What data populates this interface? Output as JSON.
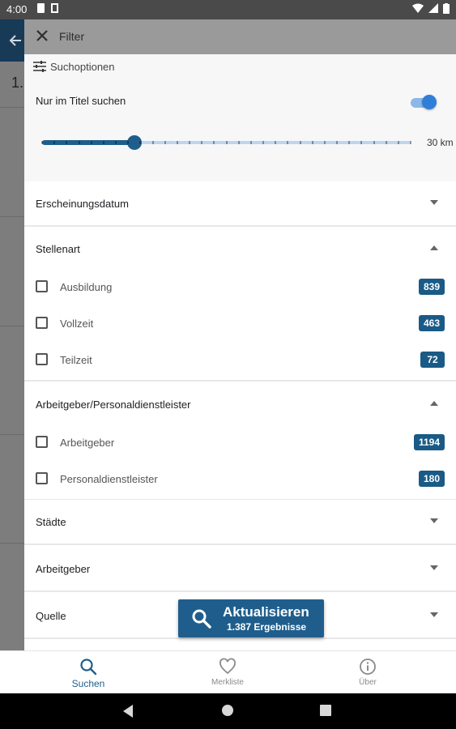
{
  "status_bar": {
    "time": "4:00"
  },
  "background": {
    "title_partial": "1."
  },
  "filter_header": {
    "title": "Filter"
  },
  "search_options": {
    "heading": "Suchoptionen",
    "title_only_label": "Nur im Titel suchen",
    "title_only_enabled": true,
    "radius_value_label": "30 km",
    "radius_fraction": 0.25
  },
  "sections": {
    "erscheinungsdatum": {
      "label": "Erscheinungsdatum",
      "expanded": false
    },
    "stellenart": {
      "label": "Stellenart",
      "expanded": true,
      "items": [
        {
          "label": "Ausbildung",
          "count": "839",
          "checked": false
        },
        {
          "label": "Vollzeit",
          "count": "463",
          "checked": false
        },
        {
          "label": "Teilzeit",
          "count": "72",
          "checked": false
        }
      ]
    },
    "arbeitgeber_personal": {
      "label": "Arbeitgeber/Personaldienstleister",
      "expanded": true,
      "items": [
        {
          "label": "Arbeitgeber",
          "count": "1194",
          "checked": false
        },
        {
          "label": "Personaldienstleister",
          "count": "180",
          "checked": false
        }
      ]
    },
    "staedte": {
      "label": "Städte",
      "expanded": false
    },
    "arbeitgeber": {
      "label": "Arbeitgeber",
      "expanded": false
    },
    "quelle": {
      "label": "Quelle",
      "expanded": false
    }
  },
  "update_button": {
    "label": "Aktualisieren",
    "results": "1.387 Ergebnisse"
  },
  "bottom_nav": {
    "search": "Suchen",
    "bookmarks": "Merkliste",
    "about": "Über"
  },
  "colors": {
    "primary": "#1f5e8c",
    "badge": "#1a5a86",
    "switch_on": "#2f7fd8"
  }
}
